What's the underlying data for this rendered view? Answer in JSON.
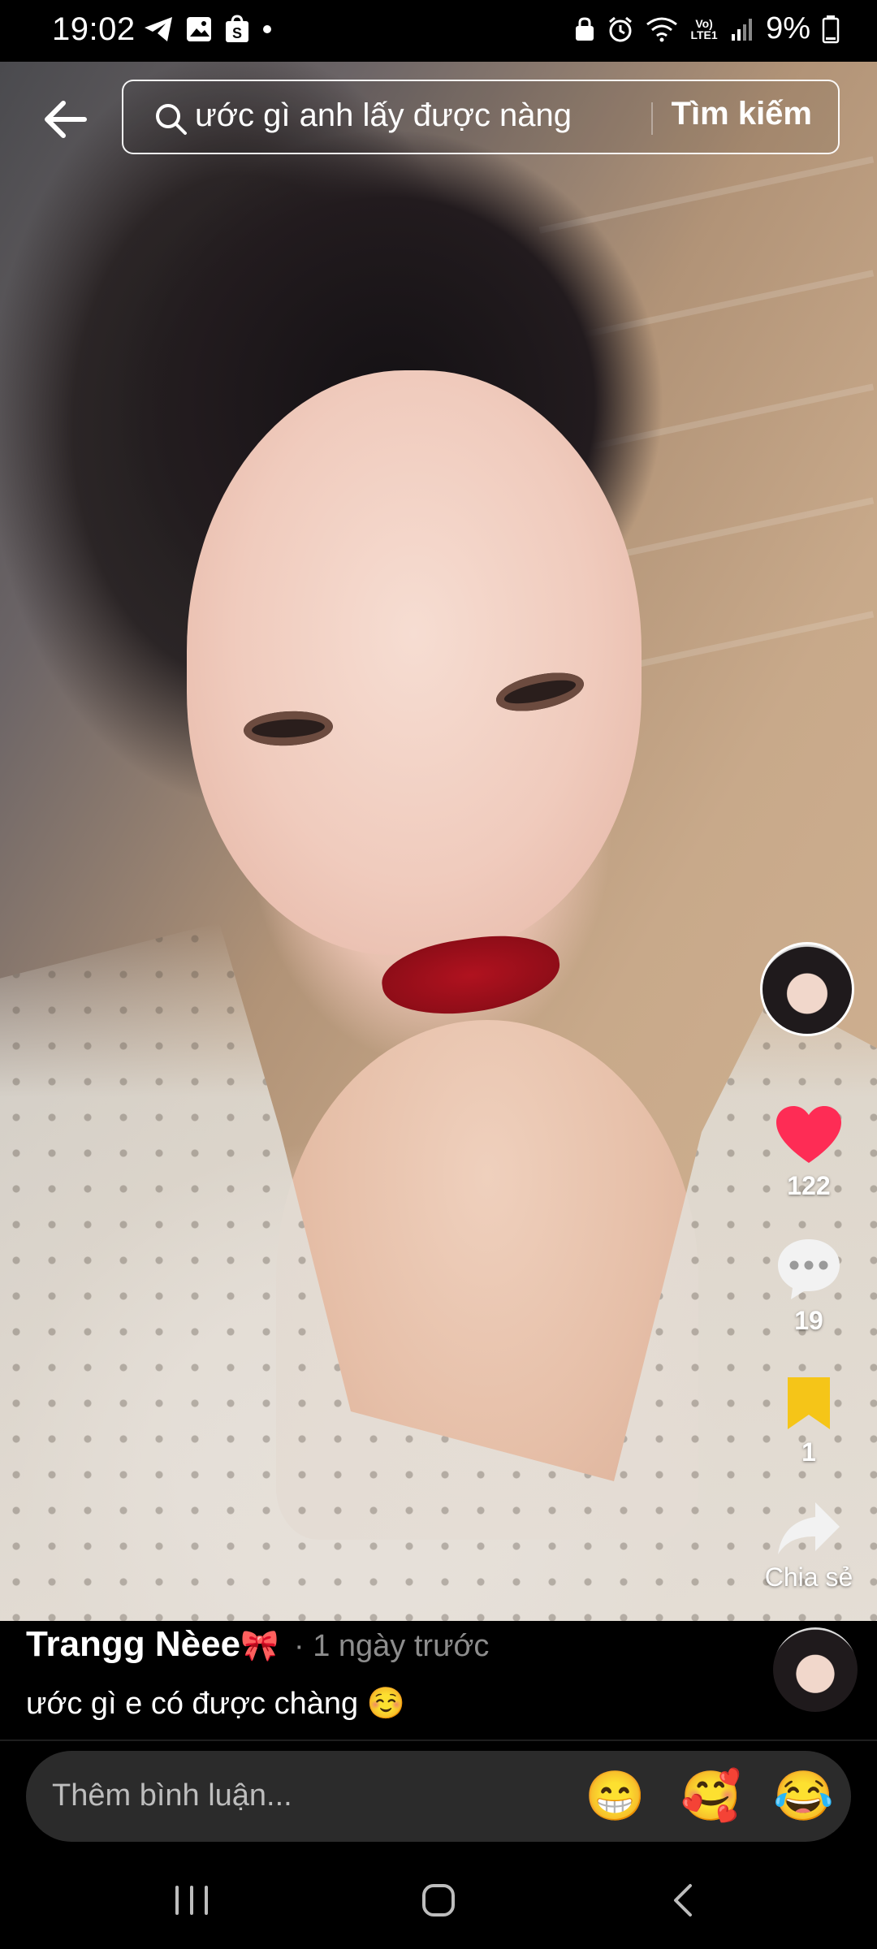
{
  "status_bar": {
    "time": "19:02",
    "left_icons": [
      "telegram-icon",
      "gallery-icon",
      "shopee-icon",
      "dot-icon"
    ],
    "right_icons": [
      "lock-icon",
      "alarm-icon",
      "wifi-icon",
      "volte-icon",
      "signal-icon"
    ],
    "volte_label": "Vo) LTE1",
    "battery": "9%"
  },
  "search": {
    "query": "ước gì anh lấy được nàng",
    "submit_label": "Tìm kiếm"
  },
  "actions": {
    "likes": "122",
    "comments": "19",
    "saves": "1",
    "share_label": "Chia sẻ",
    "like_color": "#fe2c55",
    "save_color": "#f5c518"
  },
  "post": {
    "author": "Trangg Nèee",
    "author_emoji": "🎀",
    "time_ago": "· 1 ngày trước",
    "caption": "ước gì e có được chàng ☺️"
  },
  "comment_bar": {
    "placeholder": "Thêm bình luận...",
    "emojis": [
      "😁",
      "🥰",
      "😂"
    ]
  }
}
